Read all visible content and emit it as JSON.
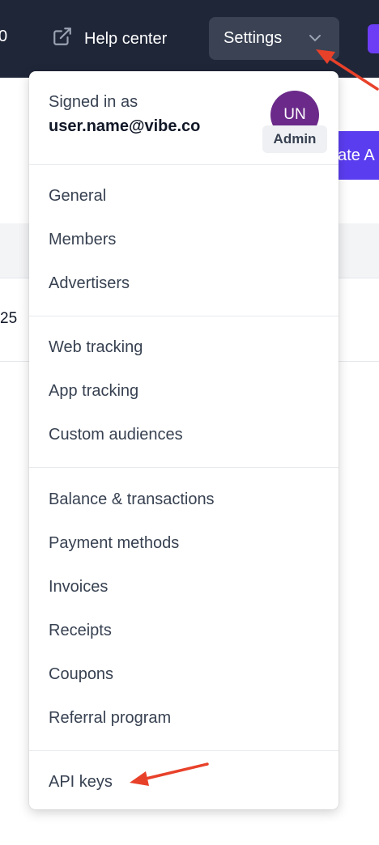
{
  "topbar": {
    "clipped_text": "0",
    "help_label": "Help center",
    "settings_label": "Settings"
  },
  "background": {
    "create_button_partial": "eate A",
    "row_value_partial": "25"
  },
  "account": {
    "signed_in_label": "Signed in as",
    "email": "user.name@vibe.co",
    "avatar_initials": "UN",
    "role": "Admin",
    "avatar_color": "#6b2a8a"
  },
  "menu": {
    "general": "General",
    "members": "Members",
    "advertisers": "Advertisers",
    "web_tracking": "Web tracking",
    "app_tracking": "App tracking",
    "custom_audiences": "Custom audiences",
    "balance": "Balance & transactions",
    "payment_methods": "Payment methods",
    "invoices": "Invoices",
    "receipts": "Receipts",
    "coupons": "Coupons",
    "referral": "Referral program",
    "api_keys": "API keys"
  },
  "colors": {
    "topbar": "#1f2638",
    "accent": "#5b3df0",
    "annotation_arrow": "#e8412a"
  }
}
